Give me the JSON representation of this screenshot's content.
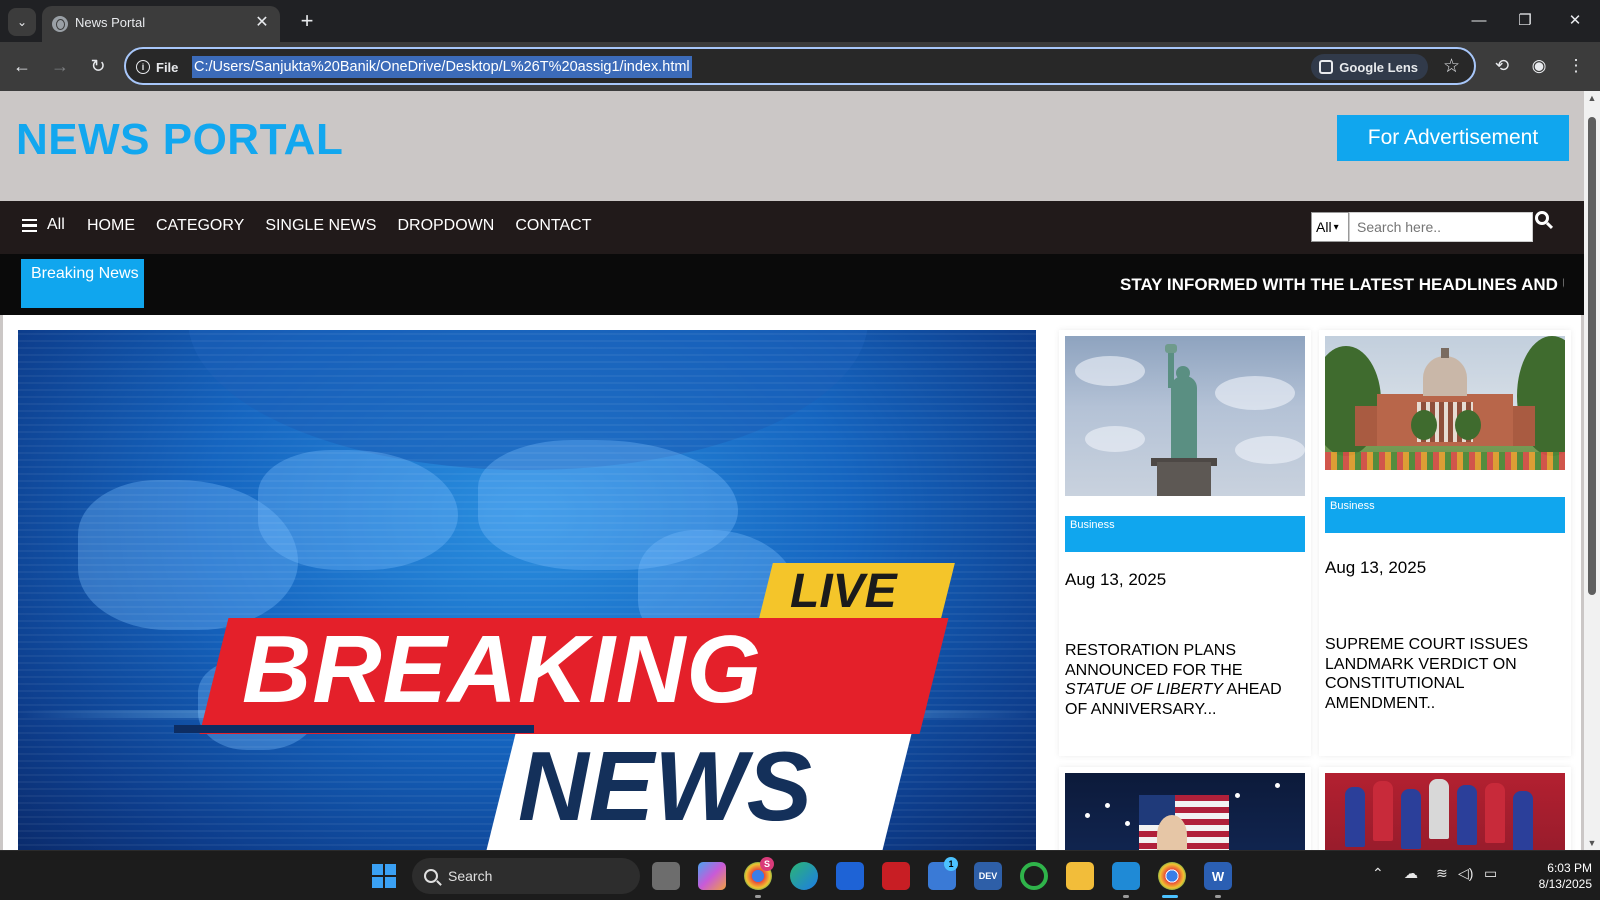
{
  "browser": {
    "tab_title": "News Portal",
    "tab_close_glyph": "✕",
    "new_tab_glyph": "+",
    "site_info_label": "File",
    "url": "C:/Users/Sanjukta%20Banik/OneDrive/Desktop/L%26T%20assig1/index.html",
    "lens_label": "Google Lens",
    "accent_color": "#a8c7fa"
  },
  "header": {
    "logo": "NEWS PORTAL",
    "ad_button": "For Advertisement",
    "brand_color": "#12a7ef"
  },
  "navbar": {
    "menu_label": "All",
    "links": [
      "HOME",
      "CATEGORY",
      "SINGLE NEWS",
      "DROPDOWN",
      "CONTACT"
    ],
    "search_category": "All",
    "search_placeholder": "Search here.."
  },
  "breaking": {
    "label": "Breaking News",
    "ticker": "STAY INFORMED WITH THE LATEST HEADLINES AND UPDATES"
  },
  "hero": {
    "live": "LIVE",
    "breaking": "BREAKING",
    "news": "NEWS"
  },
  "cards": [
    {
      "category": "Business",
      "date": "Aug 13, 2025",
      "title_pre": "RESTORATION PLANS ANNOUNCED FOR THE ",
      "title_em": "STATUE OF LIBERTY",
      "title_post": " AHEAD OF ANNIVERSARY...",
      "image": "statue-of-liberty"
    },
    {
      "category": "Business",
      "date": "Aug 13, 2025",
      "title_pre": "SUPREME COURT ISSUES LANDMARK VERDICT ON CONSTITUTIONAL AMENDMENT..",
      "title_em": "",
      "title_post": "",
      "image": "supreme-court"
    }
  ],
  "taskbar": {
    "search_label": "Search",
    "time": "6:03 PM",
    "date": "8/13/2025",
    "badges": {
      "chrome": "S",
      "store": "1"
    }
  }
}
